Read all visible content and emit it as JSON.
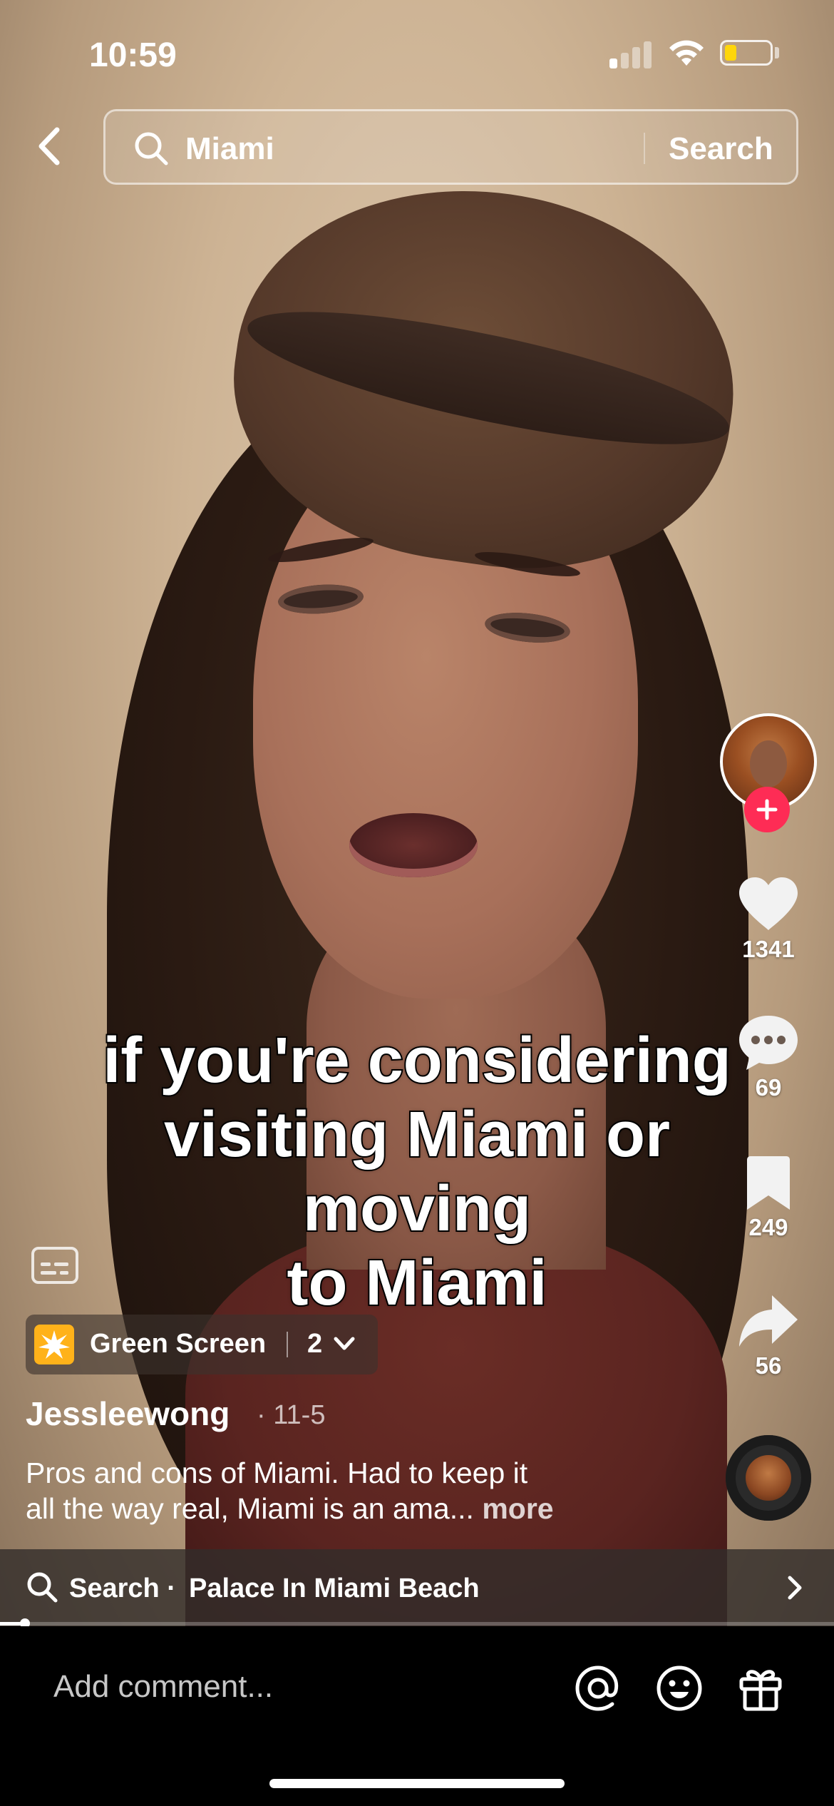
{
  "status_bar": {
    "time": "10:59",
    "battery_level": 0.25,
    "battery_color": "#ffd60a"
  },
  "header": {
    "search_query": "Miami",
    "search_button": "Search"
  },
  "video": {
    "captions": [
      "if you're considering",
      "visiting Miami or moving",
      "to Miami"
    ]
  },
  "actions": {
    "likes": "1341",
    "comments": "69",
    "saves": "249",
    "shares": "56",
    "follow_color": "#fe2c55"
  },
  "effect": {
    "label": "Green Screen",
    "count": "2"
  },
  "post": {
    "username": "Jessleewong",
    "date": "· 11-5",
    "description_line1": "Pros and cons of Miami. Had to keep it",
    "description_line2": "all the way real, Miami is an ama...",
    "more": "more"
  },
  "related_search": {
    "prefix": "Search ·",
    "query": "Palace In Miami Beach"
  },
  "progress": 0.03,
  "comment_bar": {
    "placeholder": "Add comment...",
    "icons": [
      "at-icon",
      "emoji-icon",
      "gift-icon"
    ]
  }
}
